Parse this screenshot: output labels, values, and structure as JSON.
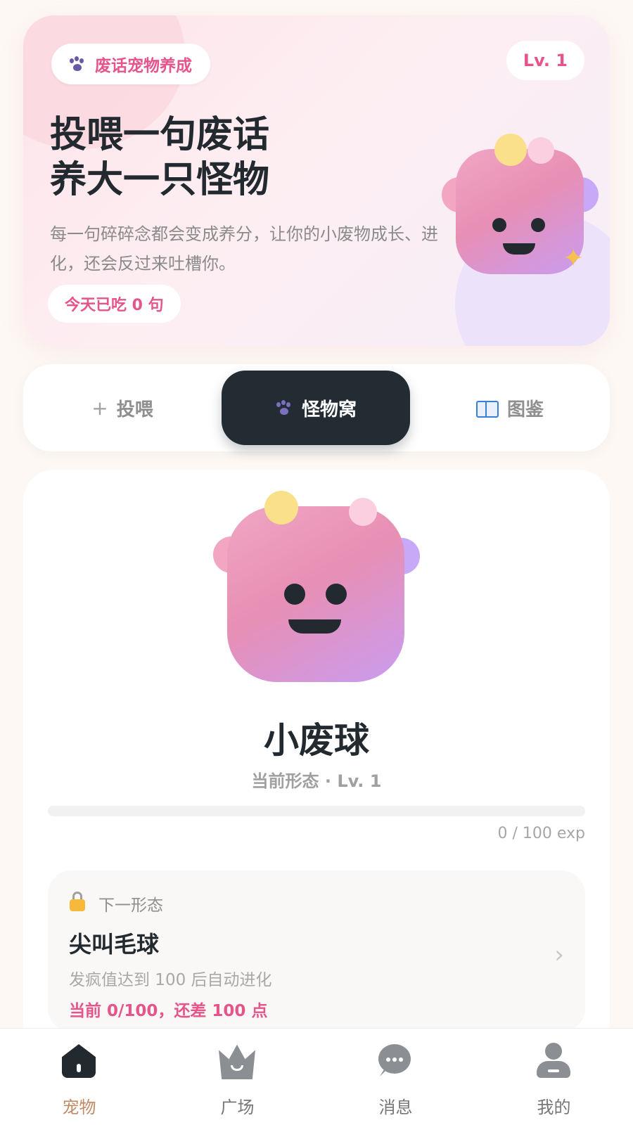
{
  "hero": {
    "chip_label": "废话宠物养成",
    "level_badge": "Lv. 1",
    "title_line1": "投喂一句废话",
    "title_line2": "养大一只怪物",
    "description": "每一句碎碎念都会变成养分，让你的小废物成长、进化，还会反过来吐槽你。",
    "today_fed": "今天已吃 0 句",
    "icons": [
      "paw-icon",
      "sparkle-icon"
    ]
  },
  "tabs": [
    {
      "icon": "plus-icon",
      "label": "投喂"
    },
    {
      "icon": "paw-icon",
      "label": "怪物窝",
      "active": true
    },
    {
      "icon": "book-icon",
      "label": "图鉴"
    }
  ],
  "pet": {
    "name": "小废球",
    "form_level": "当前形态 · Lv. 1",
    "exp_current": 0,
    "exp_max": 100,
    "exp_text": "0 / 100 exp"
  },
  "next_form": {
    "label": "下一形态",
    "name": "尖叫毛球",
    "condition": "发疯值达到 100 后自动进化",
    "progress": "当前 0/100，还差 100 点",
    "icon": "lock-icon"
  },
  "bottom_nav": [
    {
      "icon": "home-icon",
      "label": "宠物",
      "active": true
    },
    {
      "icon": "crown-icon",
      "label": "广场"
    },
    {
      "icon": "chat-icon",
      "label": "消息"
    },
    {
      "icon": "user-icon",
      "label": "我的"
    }
  ],
  "colors": {
    "accent_pink": "#e5548b",
    "dark": "#22292f",
    "monster_pink": "#e88fb4",
    "monster_purple": "#c99cf0",
    "nav_active": "#c08a66"
  }
}
